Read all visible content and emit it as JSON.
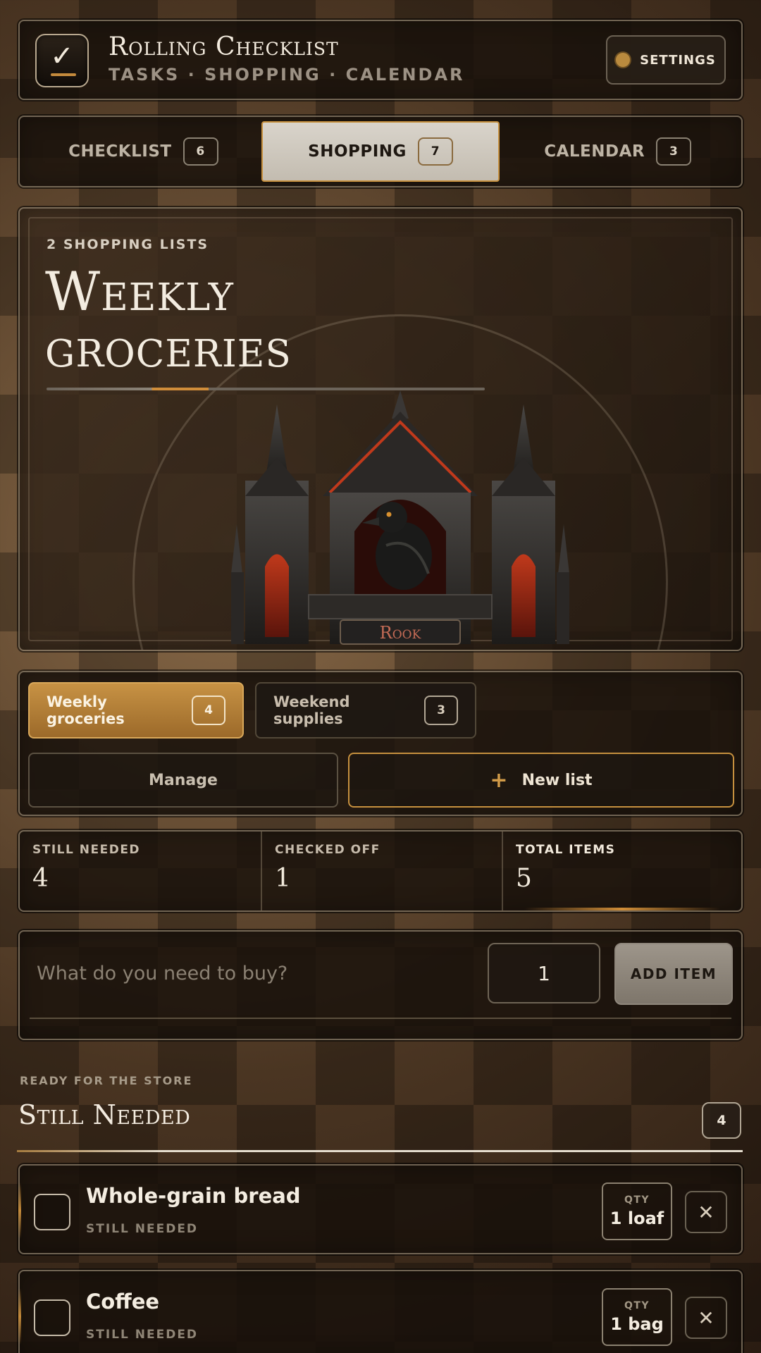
{
  "header": {
    "title": "Rolling Checklist",
    "subtitle": "TASKS · SHOPPING · CALENDAR",
    "settings_label": "SETTINGS"
  },
  "tabs": [
    {
      "label": "CHECKLIST",
      "count": "6",
      "active": false
    },
    {
      "label": "SHOPPING",
      "count": "7",
      "active": true
    },
    {
      "label": "CALENDAR",
      "count": "3",
      "active": false
    }
  ],
  "hero": {
    "count_label": "2 SHOPPING LISTS",
    "title": "Weekly groceries",
    "illustration_label": "Rook",
    "progress_fraction": 0.2
  },
  "lists": {
    "items": [
      {
        "label": "Weekly groceries",
        "count": "4",
        "selected": true
      },
      {
        "label": "Weekend supplies",
        "count": "3",
        "selected": false
      }
    ],
    "manage_label": "Manage",
    "new_list_label": "New list",
    "new_list_icon": "plus-icon"
  },
  "stats": [
    {
      "label": "STILL NEEDED",
      "value": "4"
    },
    {
      "label": "CHECKED OFF",
      "value": "1"
    },
    {
      "label": "TOTAL ITEMS",
      "value": "5"
    }
  ],
  "add_item": {
    "placeholder": "What do you need to buy?",
    "quantity_value": "1",
    "button_label": "ADD ITEM"
  },
  "section": {
    "eyebrow": "READY FOR THE STORE",
    "title": "Still Needed",
    "count": "4"
  },
  "items": [
    {
      "name": "Whole-grain bread",
      "status": "STILL NEEDED",
      "qty_label": "QTY",
      "qty": "1 loaf",
      "remove_icon": "close-icon"
    },
    {
      "name": "Coffee",
      "status": "STILL NEEDED",
      "qty_label": "QTY",
      "qty": "1 bag",
      "remove_icon": "close-icon"
    }
  ],
  "colors": {
    "accent": "#c6903e",
    "panel": "#18110b",
    "text": "#f3ece0"
  }
}
